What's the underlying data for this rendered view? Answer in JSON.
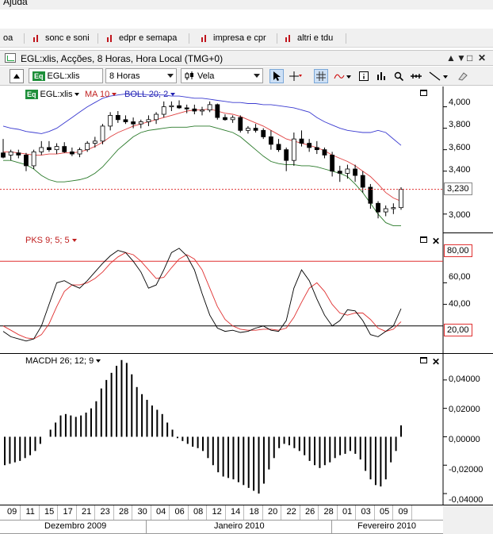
{
  "menubar": {
    "help_label": "Ajuda"
  },
  "tabs": [
    {
      "label": "oa"
    },
    {
      "label": "sonc e soni"
    },
    {
      "label": "edpr e semapa"
    },
    {
      "label": "impresa e cpr"
    },
    {
      "label": "altri e tdu"
    }
  ],
  "window": {
    "title": "EGL:xlis, Acções, 8 Horas, Hora Local (TMG+0)",
    "buttons": [
      "▲",
      "▼",
      "□",
      "✕"
    ]
  },
  "toolbar": {
    "badge": "Eq",
    "symbol": "EGL:xlis",
    "interval": "8 Horas",
    "chart_type": "Vela"
  },
  "price_pane": {
    "symbol_badge": "Eq",
    "symbol_label": "EGL:xlis",
    "ma_label": "MA 10",
    "boll_label": "BOLL 20; 2",
    "y_ticks": [
      "4,000",
      "3,800",
      "3,600",
      "3,400",
      "3,000"
    ],
    "last_price": "3,230"
  },
  "pks_pane": {
    "label": "PKS 9; 5; 5",
    "y_ticks": [
      "60,00",
      "40,00"
    ],
    "upper_level": "80,00",
    "lower_level": "20,00"
  },
  "macd_pane": {
    "label": "MACDH 26; 12; 9",
    "y_ticks": [
      "0,04000",
      "0,02000",
      "0,00000",
      "-0,02000",
      "-0,04000"
    ]
  },
  "x_axis": {
    "days": [
      "09",
      "11",
      "15",
      "17",
      "21",
      "23",
      "28",
      "30",
      "04",
      "06",
      "08",
      "12",
      "14",
      "18",
      "20",
      "22",
      "26",
      "28",
      "01",
      "03",
      "05",
      "09"
    ],
    "months": [
      "Dezembro 2009",
      "Janeiro 2010",
      "Fevereiro 2010"
    ]
  },
  "colors": {
    "bull": "#ffffff",
    "bear": "#000000",
    "ma": "#e04040",
    "boll_upper": "#3a3ad0",
    "boll_lower": "#2a7a2a",
    "level_line": "#e03030",
    "pks_k": "#000000",
    "pks_d": "#e03030"
  },
  "chart_data": [
    {
      "type": "candlestick",
      "title": "EGL:xlis",
      "ylim": [
        2.88,
        4.13
      ],
      "candles": [
        [
          3.57,
          3.7,
          3.52,
          3.53
        ],
        [
          3.55,
          3.6,
          3.5,
          3.58
        ],
        [
          3.57,
          3.6,
          3.52,
          3.55
        ],
        [
          3.55,
          3.57,
          3.4,
          3.45
        ],
        [
          3.45,
          3.6,
          3.42,
          3.58
        ],
        [
          3.58,
          3.68,
          3.55,
          3.62
        ],
        [
          3.62,
          3.68,
          3.58,
          3.6
        ],
        [
          3.6,
          3.66,
          3.56,
          3.63
        ],
        [
          3.63,
          3.67,
          3.57,
          3.58
        ],
        [
          3.58,
          3.62,
          3.54,
          3.56
        ],
        [
          3.56,
          3.62,
          3.53,
          3.6
        ],
        [
          3.6,
          3.68,
          3.58,
          3.66
        ],
        [
          3.66,
          3.72,
          3.62,
          3.68
        ],
        [
          3.68,
          3.84,
          3.65,
          3.82
        ],
        [
          3.82,
          3.95,
          3.78,
          3.92
        ],
        [
          3.92,
          3.96,
          3.85,
          3.88
        ],
        [
          3.88,
          3.92,
          3.84,
          3.86
        ],
        [
          3.86,
          3.9,
          3.8,
          3.84
        ],
        [
          3.84,
          3.88,
          3.8,
          3.86
        ],
        [
          3.86,
          3.92,
          3.82,
          3.88
        ],
        [
          3.88,
          3.95,
          3.84,
          3.93
        ],
        [
          3.93,
          4.05,
          3.9,
          4.0
        ],
        [
          4.0,
          4.05,
          3.96,
          4.01
        ],
        [
          4.01,
          4.06,
          3.98,
          3.99
        ],
        [
          3.99,
          4.02,
          3.94,
          3.98
        ],
        [
          3.98,
          4.02,
          3.93,
          3.96
        ],
        [
          3.96,
          4.0,
          3.92,
          3.97
        ],
        [
          3.97,
          4.05,
          3.95,
          4.02
        ],
        [
          4.02,
          4.03,
          3.88,
          3.9
        ],
        [
          3.9,
          3.93,
          3.87,
          3.88
        ],
        [
          3.88,
          3.92,
          3.85,
          3.9
        ],
        [
          3.9,
          3.92,
          3.76,
          3.78
        ],
        [
          3.78,
          3.82,
          3.75,
          3.8
        ],
        [
          3.8,
          3.84,
          3.76,
          3.78
        ],
        [
          3.78,
          3.8,
          3.7,
          3.72
        ],
        [
          3.72,
          3.78,
          3.6,
          3.65
        ],
        [
          3.65,
          3.7,
          3.58,
          3.6
        ],
        [
          3.6,
          3.62,
          3.4,
          3.5
        ],
        [
          3.5,
          3.76,
          3.45,
          3.7
        ],
        [
          3.7,
          3.78,
          3.63,
          3.66
        ],
        [
          3.66,
          3.7,
          3.58,
          3.62
        ],
        [
          3.62,
          3.68,
          3.56,
          3.6
        ],
        [
          3.6,
          3.62,
          3.52,
          3.55
        ],
        [
          3.55,
          3.58,
          3.35,
          3.4
        ],
        [
          3.4,
          3.45,
          3.3,
          3.38
        ],
        [
          3.38,
          3.46,
          3.33,
          3.42
        ],
        [
          3.42,
          3.46,
          3.3,
          3.36
        ],
        [
          3.36,
          3.4,
          3.2,
          3.25
        ],
        [
          3.25,
          3.28,
          3.05,
          3.1
        ],
        [
          3.1,
          3.12,
          2.96,
          3.02
        ],
        [
          3.02,
          3.08,
          2.98,
          3.05
        ],
        [
          3.05,
          3.1,
          3.0,
          3.06
        ],
        [
          3.06,
          3.25,
          3.04,
          3.23
        ]
      ],
      "ma_10": [
        3.58,
        3.58,
        3.57,
        3.56,
        3.55,
        3.55,
        3.56,
        3.56,
        3.57,
        3.57,
        3.58,
        3.6,
        3.63,
        3.67,
        3.72,
        3.76,
        3.79,
        3.82,
        3.84,
        3.86,
        3.88,
        3.9,
        3.92,
        3.94,
        3.96,
        3.97,
        3.97,
        3.98,
        3.96,
        3.94,
        3.93,
        3.91,
        3.88,
        3.85,
        3.82,
        3.78,
        3.74,
        3.7,
        3.68,
        3.66,
        3.64,
        3.62,
        3.59,
        3.55,
        3.52,
        3.49,
        3.45,
        3.4,
        3.35,
        3.28,
        3.2,
        3.15,
        3.12
      ],
      "boll_upper": [
        3.82,
        3.8,
        3.79,
        3.77,
        3.76,
        3.75,
        3.77,
        3.8,
        3.85,
        3.9,
        3.95,
        4.0,
        4.04,
        4.08,
        4.1,
        4.11,
        4.12,
        4.12,
        4.12,
        4.11,
        4.11,
        4.11,
        4.1,
        4.1,
        4.09,
        4.08,
        4.08,
        4.07,
        4.06,
        4.05,
        4.04,
        4.04,
        4.03,
        4.03,
        4.02,
        4.02,
        4.01,
        4.0,
        3.99,
        3.97,
        3.95,
        3.9,
        3.86,
        3.83,
        3.8,
        3.78,
        3.77,
        3.76,
        3.76,
        3.78,
        3.76,
        3.7,
        3.64
      ],
      "boll_lower": [
        3.5,
        3.5,
        3.48,
        3.46,
        3.42,
        3.36,
        3.32,
        3.3,
        3.3,
        3.31,
        3.32,
        3.34,
        3.38,
        3.44,
        3.52,
        3.6,
        3.66,
        3.72,
        3.76,
        3.78,
        3.79,
        3.8,
        3.81,
        3.81,
        3.81,
        3.82,
        3.82,
        3.82,
        3.8,
        3.78,
        3.76,
        3.72,
        3.66,
        3.6,
        3.54,
        3.49,
        3.47,
        3.46,
        3.46,
        3.45,
        3.45,
        3.44,
        3.42,
        3.4,
        3.38,
        3.35,
        3.28,
        3.2,
        3.1,
        3.0,
        2.92,
        2.89,
        2.89
      ],
      "last_price": 3.23
    },
    {
      "type": "line",
      "title": "PKS 9; 5; 5",
      "ylim": [
        0,
        100
      ],
      "levels": [
        80,
        20
      ],
      "series": [
        {
          "name": "K",
          "values": [
            15,
            10,
            8,
            6,
            8,
            20,
            40,
            60,
            62,
            58,
            55,
            62,
            70,
            78,
            85,
            90,
            88,
            80,
            70,
            55,
            58,
            72,
            88,
            92,
            85,
            72,
            50,
            30,
            18,
            15,
            16,
            14,
            15,
            18,
            20,
            16,
            15,
            25,
            55,
            72,
            62,
            45,
            30,
            20,
            25,
            35,
            34,
            25,
            12,
            10,
            15,
            20,
            36
          ]
        },
        {
          "name": "D",
          "values": [
            20,
            16,
            12,
            9,
            8,
            12,
            22,
            38,
            52,
            58,
            58,
            60,
            64,
            70,
            78,
            84,
            88,
            86,
            80,
            72,
            64,
            65,
            74,
            82,
            86,
            82,
            72,
            55,
            38,
            26,
            20,
            17,
            16,
            16,
            17,
            17,
            16,
            18,
            28,
            42,
            55,
            60,
            52,
            40,
            32,
            30,
            32,
            32,
            26,
            18,
            15,
            17,
            24
          ]
        }
      ]
    },
    {
      "type": "bar",
      "title": "MACDH 26; 12; 9",
      "ylim": [
        -0.045,
        0.055
      ],
      "values": [
        -0.02,
        -0.019,
        -0.018,
        -0.017,
        -0.015,
        -0.013,
        -0.01,
        -0.005,
        0.0,
        0.005,
        0.01,
        0.015,
        0.016,
        0.015,
        0.014,
        0.015,
        0.017,
        0.02,
        0.025,
        0.034,
        0.04,
        0.045,
        0.05,
        0.054,
        0.052,
        0.044,
        0.035,
        0.03,
        0.026,
        0.022,
        0.019,
        0.016,
        0.01,
        0.005,
        -0.001,
        -0.003,
        -0.005,
        -0.007,
        -0.008,
        -0.01,
        -0.015,
        -0.02,
        -0.025,
        -0.028,
        -0.029,
        -0.03,
        -0.032,
        -0.034,
        -0.036,
        -0.038,
        -0.04,
        -0.033,
        -0.023,
        -0.015,
        -0.008,
        -0.005,
        -0.006,
        -0.008,
        -0.01,
        -0.013,
        -0.017,
        -0.02,
        -0.022,
        -0.02,
        -0.018,
        -0.015,
        -0.013,
        -0.012,
        -0.01,
        -0.012,
        -0.016,
        -0.024,
        -0.03,
        -0.034,
        -0.035,
        -0.03,
        -0.018,
        -0.01,
        0.008
      ]
    }
  ]
}
